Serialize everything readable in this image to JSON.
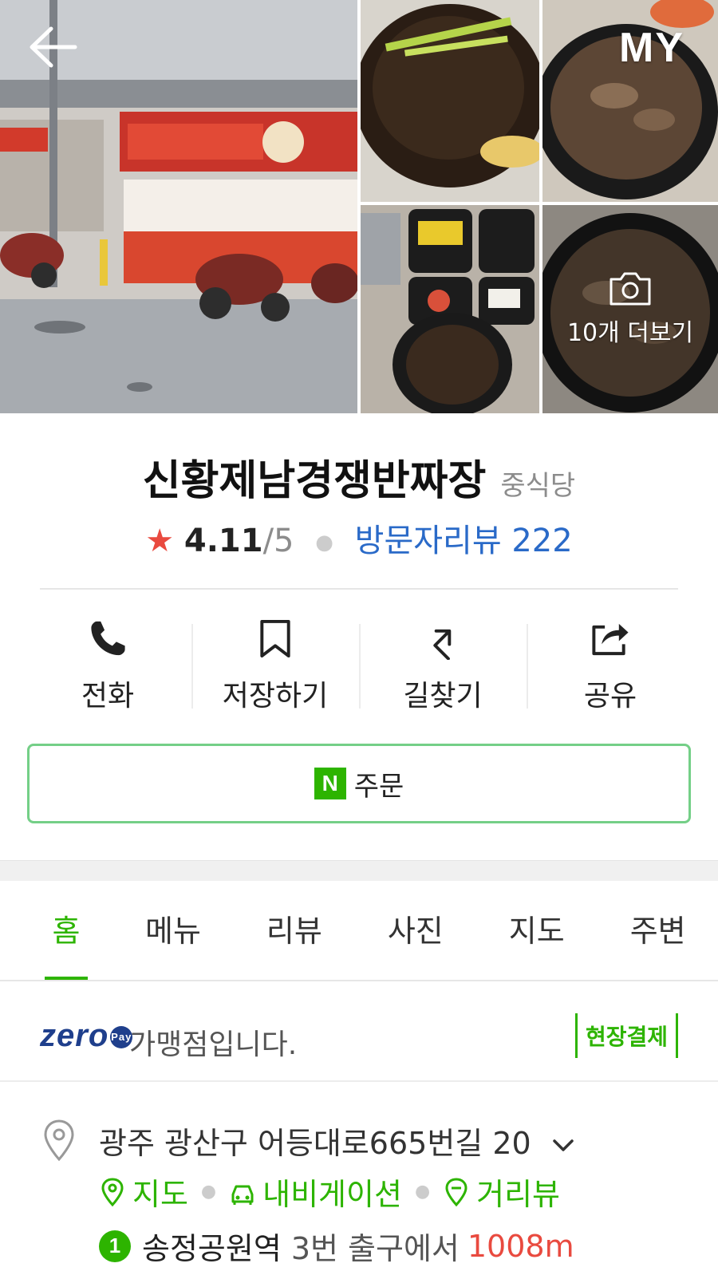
{
  "header": {
    "my_label": "MY",
    "more_photos_label": "10개 더보기"
  },
  "place": {
    "name": "신황제남경쟁반짜장",
    "category": "중식당",
    "rating": "4.11",
    "rating_max": "/5",
    "review_label": "방문자리뷰 222"
  },
  "actions": [
    {
      "label": "전화",
      "icon": "phone-icon"
    },
    {
      "label": "저장하기",
      "icon": "bookmark-icon"
    },
    {
      "label": "길찾기",
      "icon": "directions-icon"
    },
    {
      "label": "공유",
      "icon": "share-icon"
    }
  ],
  "order": {
    "logo": "N",
    "label": "주문"
  },
  "tabs": [
    "홈",
    "메뉴",
    "리뷰",
    "사진",
    "지도",
    "주변"
  ],
  "zero_pay": {
    "logo_text": "zero",
    "badge_text": "Pay",
    "text": "가맹점입니다.",
    "onsite_label": "현장결제"
  },
  "address": {
    "text": "광주 광산구 어등대로665번길 20",
    "links": [
      "지도",
      "내비게이션",
      "거리뷰"
    ]
  },
  "subway": {
    "line": "1",
    "station": "송정공원역",
    "exit": "3번 출구에서",
    "distance": "1008m"
  },
  "colors": {
    "accent_green": "#2db400",
    "link_blue": "#2a6ac8",
    "star_red": "#e94a3f"
  }
}
